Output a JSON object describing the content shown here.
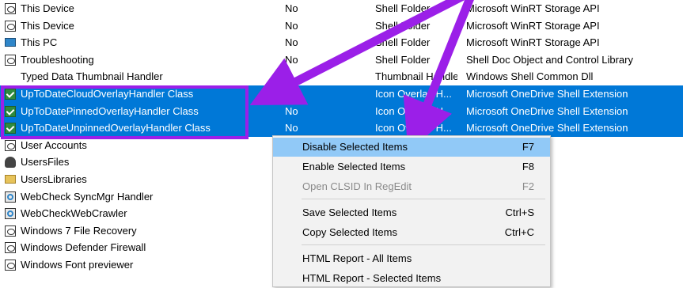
{
  "rows": [
    {
      "name": "This Device",
      "disabled": "No",
      "type": "Shell Folder",
      "desc": "Microsoft WinRT Storage API",
      "icon": "doc-icon"
    },
    {
      "name": "This Device",
      "disabled": "No",
      "type": "Shell Folder",
      "desc": "Microsoft WinRT Storage API",
      "icon": "doc-icon"
    },
    {
      "name": "This PC",
      "disabled": "No",
      "type": "Shell Folder",
      "desc": "Microsoft WinRT Storage API",
      "icon": "computer-icon"
    },
    {
      "name": "Troubleshooting",
      "disabled": "No",
      "type": "Shell Folder",
      "desc": "Shell Doc Object and Control Library",
      "icon": "doc-icon"
    },
    {
      "name": "Typed Data Thumbnail Handler",
      "disabled": "",
      "type": "Thumbnail Handler",
      "desc": "Windows Shell Common Dll",
      "icon": "none"
    },
    {
      "name": "UpToDateCloudOverlayHandler Class",
      "disabled": "No",
      "type": "Icon Overlay H...",
      "desc": "Microsoft OneDrive Shell Extension",
      "icon": "check-icon",
      "selected": true
    },
    {
      "name": "UpToDatePinnedOverlayHandler Class",
      "disabled": "No",
      "type": "Icon Overlay H...",
      "desc": "Microsoft OneDrive Shell Extension",
      "icon": "check-icon",
      "selected": true
    },
    {
      "name": "UpToDateUnpinnedOverlayHandler Class",
      "disabled": "No",
      "type": "Icon Overlay H...",
      "desc": "Microsoft OneDrive Shell Extension",
      "icon": "check-icon",
      "selected": true
    },
    {
      "name": "User Accounts",
      "disabled": "",
      "type": "",
      "desc": "nd Control Library",
      "icon": "doc-icon"
    },
    {
      "name": "UsersFiles",
      "disabled": "",
      "type": "",
      "desc": "torage API",
      "icon": "user-icon"
    },
    {
      "name": "UsersLibraries",
      "disabled": "",
      "type": "",
      "desc": "torage API",
      "icon": "folder-icon"
    },
    {
      "name": "WebCheck SyncMgr Handler",
      "disabled": "",
      "type": "",
      "desc": "",
      "icon": "sync-icon"
    },
    {
      "name": "WebCheckWebCrawler",
      "disabled": "",
      "type": "",
      "desc": "",
      "icon": "sync-icon"
    },
    {
      "name": "Windows 7 File Recovery",
      "disabled": "",
      "type": "",
      "desc": "nd Control Library",
      "icon": "doc-icon"
    },
    {
      "name": "Windows Defender Firewall",
      "disabled": "",
      "type": "",
      "desc": "nd Control Library",
      "icon": "doc-icon"
    },
    {
      "name": "Windows Font previewer",
      "disabled": "",
      "type": "",
      "desc": "der",
      "icon": "doc-icon"
    }
  ],
  "menu": {
    "items": [
      {
        "label": "Disable Selected Items",
        "key": "F7",
        "state": "hover"
      },
      {
        "label": "Enable Selected Items",
        "key": "F8",
        "state": "normal"
      },
      {
        "label": "Open CLSID In RegEdit",
        "key": "F2",
        "state": "disabled"
      },
      {
        "label": "Save Selected Items",
        "key": "Ctrl+S",
        "state": "normal"
      },
      {
        "label": "Copy Selected Items",
        "key": "Ctrl+C",
        "state": "normal"
      },
      {
        "label": "HTML Report - All Items",
        "key": "",
        "state": "normal"
      },
      {
        "label": "HTML Report - Selected Items",
        "key": "",
        "state": "normal"
      }
    ]
  },
  "colors": {
    "selection": "#0078d7",
    "annotation": "#9b1fe8",
    "menu_hover": "#91c9f7"
  }
}
